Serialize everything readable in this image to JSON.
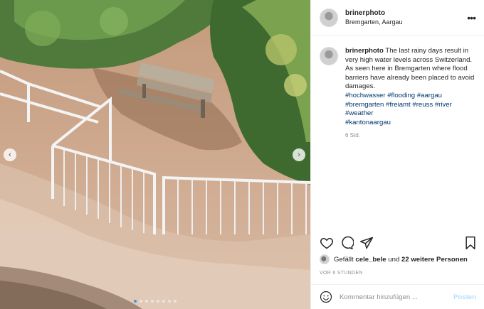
{
  "post": {
    "username": "brinerphoto",
    "location": "Bremgarten, Aargau",
    "more_icon": "more-options-icon"
  },
  "caption": {
    "username": "brinerphoto",
    "text": "The last rainy days result in very high water levels across Switzerland. As seen here in Bremgarten where flood barriers have already been placed to avoid damages.",
    "hashtags": [
      "#hochwasser #flooding #aargau",
      "#bremgarten #freiamt #reuss #river",
      "#weather",
      "#kantonaargau"
    ],
    "time": "6 Std."
  },
  "actions": {
    "icons": [
      "heart-icon",
      "comment-icon",
      "share-icon",
      "bookmark-icon"
    ]
  },
  "likes": {
    "prefix": "Gefällt",
    "user": "cele_bele",
    "middle": "und",
    "others": "22 weitere Personen"
  },
  "timestamp": "VOR 6 STUNDEN",
  "comment_box": {
    "placeholder": "Kommentar hinzufügen ...",
    "post_label": "Posten"
  },
  "carousel": {
    "prev": "‹",
    "next": "›",
    "slides": 8,
    "active_slide": 1
  },
  "colors": {
    "hashtag": "#00376b",
    "post_disabled": "#b2dffc",
    "carousel_active": "#3897f0"
  }
}
